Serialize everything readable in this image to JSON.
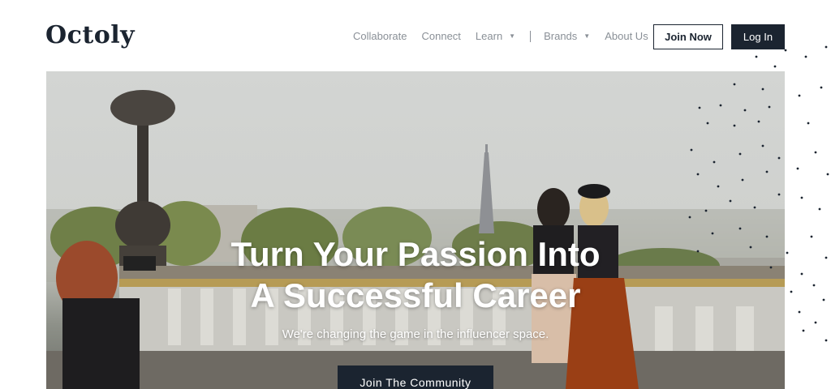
{
  "brand": {
    "logo_text": "Octoly"
  },
  "nav": {
    "items": [
      {
        "label": "Collaborate",
        "dropdown": false
      },
      {
        "label": "Connect",
        "dropdown": false
      },
      {
        "label": "Learn",
        "dropdown": true
      },
      {
        "label": "Brands",
        "dropdown": true
      },
      {
        "label": "About Us",
        "dropdown": false
      }
    ],
    "join_label": "Join Now",
    "login_label": "Log In"
  },
  "hero": {
    "title_line1": "Turn Your Passion Into",
    "title_line2": "A Successful Career",
    "subtitle": "We're changing the game in the influencer space.",
    "cta_label": "Join The Community"
  },
  "colors": {
    "primary": "#1b2430",
    "nav_text": "#8a9097",
    "background": "#ffffff"
  },
  "icons": {
    "dropdown": "chevron-down-icon"
  }
}
